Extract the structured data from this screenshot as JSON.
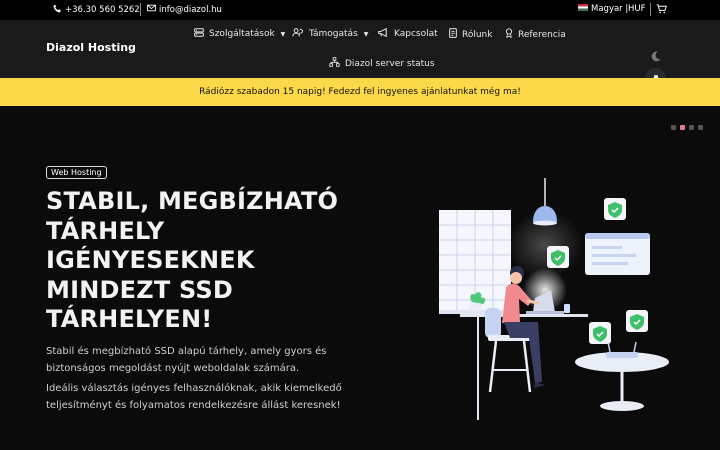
{
  "topbar": {
    "phone": "+36.30 560 5262",
    "email": "info@diazol.hu",
    "language": "Magyar |",
    "currency": "HUF"
  },
  "nav": {
    "brand": "Diazol Hosting",
    "items": [
      {
        "label": "Szolgáltatások",
        "icon": "services-icon",
        "dropdown": true
      },
      {
        "label": "Támogatás",
        "icon": "support-icon",
        "dropdown": true
      },
      {
        "label": "Kapcsolat",
        "icon": "megaphone-icon",
        "dropdown": false
      },
      {
        "label": "Rólunk",
        "icon": "document-icon",
        "dropdown": false
      },
      {
        "label": "Referencia",
        "icon": "award-icon",
        "dropdown": false
      },
      {
        "label": "Diazol server status",
        "icon": "network-icon",
        "dropdown": false
      }
    ]
  },
  "promo": {
    "text": "Rádiózz szabadon 15 napig! Fedezd fel ingyenes ajánlatunkat még ma!"
  },
  "hero": {
    "badge": "Web Hosting",
    "title_lines": [
      "STABIL, MEGBÍZHATÓ",
      "TÁRHELY",
      "IGÉNYESEKNEK",
      "MINDEZT SSD",
      "TÁRHELYEN!"
    ],
    "paragraph1": "Stabil és megbízható SSD alapú tárhely, amely gyors és biztonságos megoldást nyújt weboldalak számára.",
    "paragraph2": "Ideális választás igényes felhasználóknak, akik kiemelkedő teljesítményt és folyamatos rendelkezésre állást keresnek!",
    "carousel": {
      "slides": 4,
      "active_index": 1
    }
  },
  "colors": {
    "promo_bg": "#fcd949",
    "nav_bg": "#1a1a1b",
    "hero_bg": "#0b0b0c",
    "accent_green": "#3fbf6b",
    "figure_shirt": "#f08a8e"
  }
}
